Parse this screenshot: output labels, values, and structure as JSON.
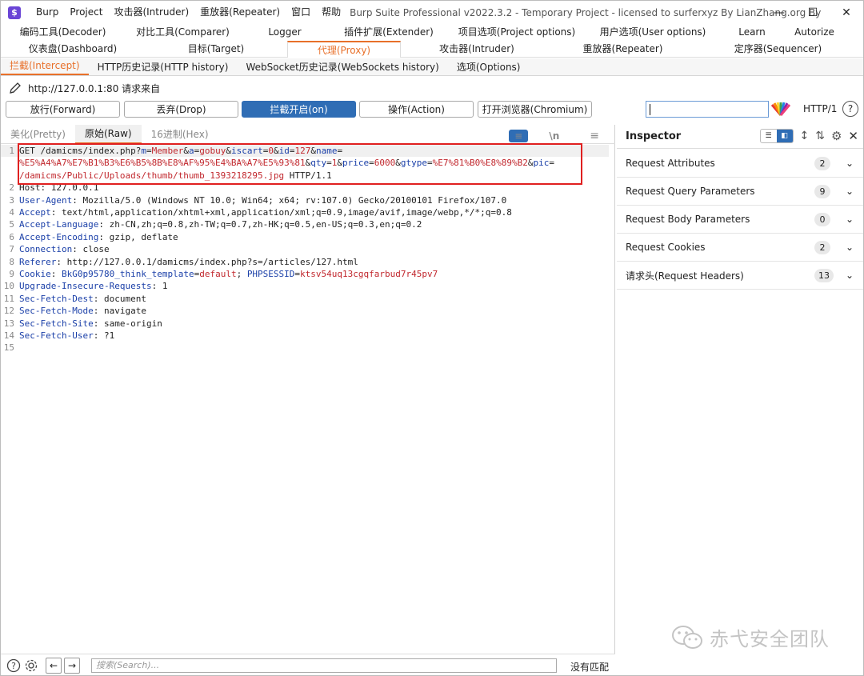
{
  "window": {
    "menu": [
      "Burp",
      "Project",
      "攻击器(Intruder)",
      "重放器(Repeater)",
      "窗口",
      "帮助"
    ],
    "title": "Burp Suite Professional v2022.3.2 - Temporary Project - licensed to surferxyz By LianZhang.org By LianZhang..."
  },
  "top_tabs_row1": [
    "编码工具(Decoder)",
    "对比工具(Comparer)",
    "Logger",
    "插件扩展(Extender)",
    "项目选项(Project options)",
    "用户选项(User options)",
    "Learn",
    "Autorize"
  ],
  "top_tabs_row2": [
    "仪表盘(Dashboard)",
    "目标(Target)",
    "代理(Proxy)",
    "攻击器(Intruder)",
    "重放器(Repeater)",
    "定序器(Sequencer)"
  ],
  "sub_tabs": [
    "拦截(Intercept)",
    "HTTP历史记录(HTTP history)",
    "WebSocket历史记录(WebSockets history)",
    "选项(Options)"
  ],
  "request_from": "http://127.0.0.1:80 请求来自",
  "actions": {
    "forward": "放行(Forward)",
    "drop": "丢弃(Drop)",
    "intercept": "拦截开启(on)",
    "action": "操作(Action)",
    "browser": "打开浏览器(Chromium)",
    "http_version": "HTTP/1",
    "help": "?"
  },
  "editor": {
    "tabs": [
      "美化(Pretty)",
      "原始(Raw)",
      "16进制(Hex)"
    ],
    "newline_toggle": "\\n",
    "line_numbers": [
      "1",
      "",
      "",
      "2",
      "3",
      "4",
      "5",
      "6",
      "7",
      "8",
      "9",
      "10",
      "11",
      "12",
      "13",
      "14",
      "15"
    ],
    "line1": [
      {
        "t": "GET /damicms/index.php?",
        "c": "p"
      },
      {
        "t": "m",
        "c": "k"
      },
      {
        "t": "=",
        "c": "p"
      },
      {
        "t": "Member",
        "c": "v"
      },
      {
        "t": "&",
        "c": "p"
      },
      {
        "t": "a",
        "c": "k"
      },
      {
        "t": "=",
        "c": "p"
      },
      {
        "t": "gobuy",
        "c": "v"
      },
      {
        "t": "&",
        "c": "p"
      },
      {
        "t": "iscart",
        "c": "k"
      },
      {
        "t": "=",
        "c": "p"
      },
      {
        "t": "0",
        "c": "v"
      },
      {
        "t": "&",
        "c": "p"
      },
      {
        "t": "id",
        "c": "k"
      },
      {
        "t": "=",
        "c": "p"
      },
      {
        "t": "127",
        "c": "v"
      },
      {
        "t": "&",
        "c": "p"
      },
      {
        "t": "name",
        "c": "k"
      },
      {
        "t": "=",
        "c": "p"
      }
    ],
    "line1b": [
      {
        "t": "%E5%A4%A7%E7%B1%B3%E6%B5%8B%E8%AF%95%E4%BA%A7%E5%93%81",
        "c": "v"
      },
      {
        "t": "&",
        "c": "p"
      },
      {
        "t": "qty",
        "c": "k"
      },
      {
        "t": "=",
        "c": "p"
      },
      {
        "t": "1",
        "c": "v"
      },
      {
        "t": "&",
        "c": "p"
      },
      {
        "t": "price",
        "c": "k"
      },
      {
        "t": "=",
        "c": "p"
      },
      {
        "t": "6000",
        "c": "v"
      },
      {
        "t": "&",
        "c": "p"
      },
      {
        "t": "gtype",
        "c": "k"
      },
      {
        "t": "=",
        "c": "p"
      },
      {
        "t": "%E7%81%B0%E8%89%B2",
        "c": "v"
      },
      {
        "t": "&",
        "c": "p"
      },
      {
        "t": "pic",
        "c": "k"
      },
      {
        "t": "=",
        "c": "p"
      }
    ],
    "line1c": [
      {
        "t": "/damicms/Public/Uploads/thumb/thumb_1393218295.jpg",
        "c": "v"
      },
      {
        "t": " HTTP/1.1",
        "c": "p"
      }
    ],
    "headers": [
      [
        {
          "t": "Host: 127.0.0.1",
          "c": "p"
        }
      ],
      [
        {
          "t": "User-Agent",
          "c": "k"
        },
        {
          "t": ": Mozilla/5.0 (Windows NT 10.0; Win64; x64; rv:107.0) Gecko/20100101 Firefox/107.0",
          "c": "p"
        }
      ],
      [
        {
          "t": "Accept",
          "c": "k"
        },
        {
          "t": ": text/html,application/xhtml+xml,application/xml;q=0.9,image/avif,image/webp,*/*;q=0.8",
          "c": "p"
        }
      ],
      [
        {
          "t": "Accept-Language",
          "c": "k"
        },
        {
          "t": ": zh-CN,zh;q=0.8,zh-TW;q=0.7,zh-HK;q=0.5,en-US;q=0.3,en;q=0.2",
          "c": "p"
        }
      ],
      [
        {
          "t": "Accept-Encoding",
          "c": "k"
        },
        {
          "t": ": gzip, deflate",
          "c": "p"
        }
      ],
      [
        {
          "t": "Connection",
          "c": "k"
        },
        {
          "t": ": close",
          "c": "p"
        }
      ],
      [
        {
          "t": "Referer",
          "c": "k"
        },
        {
          "t": ": http://127.0.0.1/damicms/index.php?s=/articles/127.html",
          "c": "p"
        }
      ],
      [
        {
          "t": "Cookie",
          "c": "k"
        },
        {
          "t": ": ",
          "c": "p"
        },
        {
          "t": "BkG0p95780_think_template",
          "c": "k"
        },
        {
          "t": "=",
          "c": "p"
        },
        {
          "t": "default",
          "c": "v"
        },
        {
          "t": "; ",
          "c": "p"
        },
        {
          "t": "PHPSESSID",
          "c": "k"
        },
        {
          "t": "=",
          "c": "p"
        },
        {
          "t": "ktsv54uq13cgqfarbud7r45pv7",
          "c": "v"
        }
      ],
      [
        {
          "t": "Upgrade-Insecure-Requests",
          "c": "k"
        },
        {
          "t": ": 1",
          "c": "p"
        }
      ],
      [
        {
          "t": "Sec-Fetch-Dest",
          "c": "k"
        },
        {
          "t": ": document",
          "c": "p"
        }
      ],
      [
        {
          "t": "Sec-Fetch-Mode",
          "c": "k"
        },
        {
          "t": ": navigate",
          "c": "p"
        }
      ],
      [
        {
          "t": "Sec-Fetch-Site",
          "c": "k"
        },
        {
          "t": ": same-origin",
          "c": "p"
        }
      ],
      [
        {
          "t": "Sec-Fetch-User",
          "c": "k"
        },
        {
          "t": ": ?1",
          "c": "p"
        }
      ],
      [
        {
          "t": "",
          "c": "p"
        }
      ]
    ]
  },
  "inspector": {
    "title": "Inspector",
    "items": [
      {
        "label": "Request Attributes",
        "count": "2"
      },
      {
        "label": "Request Query Parameters",
        "count": "9"
      },
      {
        "label": "Request Body Parameters",
        "count": "0"
      },
      {
        "label": "Request Cookies",
        "count": "2"
      },
      {
        "label": "请求头(Request Headers)",
        "count": "13"
      }
    ]
  },
  "bottom": {
    "search_placeholder": "搜索(Search)...",
    "no_match": "没有匹配"
  },
  "watermark": "赤弋安全团队",
  "colors": {
    "accent": "#e8702a",
    "primary": "#2f6db5",
    "highlight": "#e02020"
  }
}
